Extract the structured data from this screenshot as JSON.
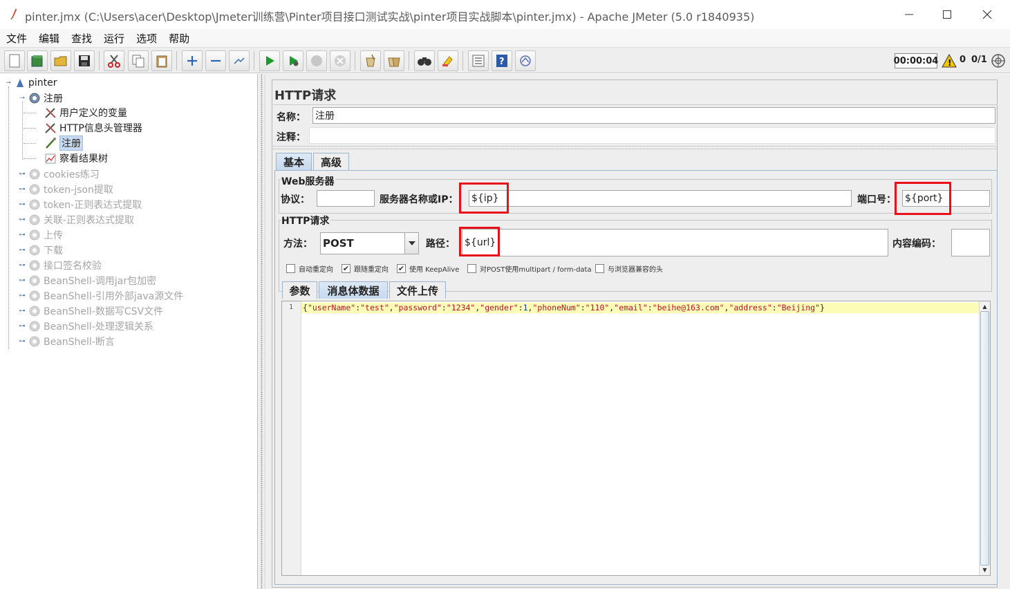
{
  "window": {
    "title": "pinter.jmx (C:\\Users\\acer\\Desktop\\Jmeter训练营\\Pinter项目接口测试实战\\pinter项目实战脚本\\pinter.jmx) - Apache JMeter (5.0 r1840935)"
  },
  "menu": [
    "文件",
    "编辑",
    "查找",
    "运行",
    "选项",
    "帮助"
  ],
  "status": {
    "timer": "00:00:04",
    "warnings": "0",
    "threads": "0/1"
  },
  "tree": {
    "root": "pinter",
    "group": "注册",
    "children": [
      "用户定义的变量",
      "HTTP信息头管理器",
      "注册",
      "察看结果树"
    ],
    "others": [
      "cookies练习",
      "token-json提取",
      "token-正则表达式提取",
      "关联-正则表达式提取",
      "上传",
      "下载",
      "接口签名校验",
      "BeanShell-调用jar包加密",
      "BeanShell-引用外部java源文件",
      "BeanShell-数据写CSV文件",
      "BeanShell-处理逻辑关系",
      "BeanShell-断言"
    ]
  },
  "panel": {
    "title": "HTTP请求",
    "name_label": "名称：",
    "name_value": "注册",
    "comment_label": "注释：",
    "tabs": [
      "基本",
      "高级"
    ],
    "web_server": {
      "title": "Web服务器",
      "protocol_label": "协议：",
      "protocol_value": "",
      "server_label": "服务器名称或IP：",
      "server_value": "${ip}",
      "port_label": "端口号：",
      "port_value": "${port}"
    },
    "http_request": {
      "title": "HTTP请求",
      "method_label": "方法：",
      "method_value": "POST",
      "path_label": "路径：",
      "path_value": "${url}",
      "encoding_label": "内容编码：",
      "encoding_value": ""
    },
    "options": [
      {
        "label": "自动重定向",
        "checked": false
      },
      {
        "label": "跟随重定向",
        "checked": true
      },
      {
        "label": "使用 KeepAlive",
        "checked": true
      },
      {
        "label": "对POST使用multipart / form-data",
        "checked": false
      },
      {
        "label": "与浏览器兼容的头",
        "checked": false
      }
    ],
    "body_tabs": [
      "参数",
      "消息体数据",
      "文件上传"
    ],
    "body": {
      "line_number": "1",
      "content": "{\"userName\":\"test\",\"password\":\"1234\",\"gender\":1,\"phoneNum\":\"110\",\"email\":\"beihe@163.com\",\"address\":\"Beijing\"}"
    }
  },
  "colors": {
    "highlight_red": "#e8101a",
    "selected_bg": "#c8daf0",
    "tab_active": "#c6d9ee",
    "string_red": "#b8142a",
    "number_blue": "#1b3fb5",
    "current_line": "#fdfcb7"
  },
  "icons": [
    "new-icon",
    "templates-icon",
    "open-icon",
    "save-icon",
    "cut-icon",
    "copy-icon",
    "paste-icon",
    "expand-icon",
    "collapse-icon",
    "toggle-icon",
    "start-icon",
    "start-no-pause-icon",
    "stop-icon",
    "shutdown-icon",
    "clear-icon",
    "clear-all-icon",
    "search-icon",
    "reset-search-icon",
    "function-helper-icon",
    "help-icon",
    "log-viewer-icon",
    "warning-icon",
    "remote-icon"
  ]
}
